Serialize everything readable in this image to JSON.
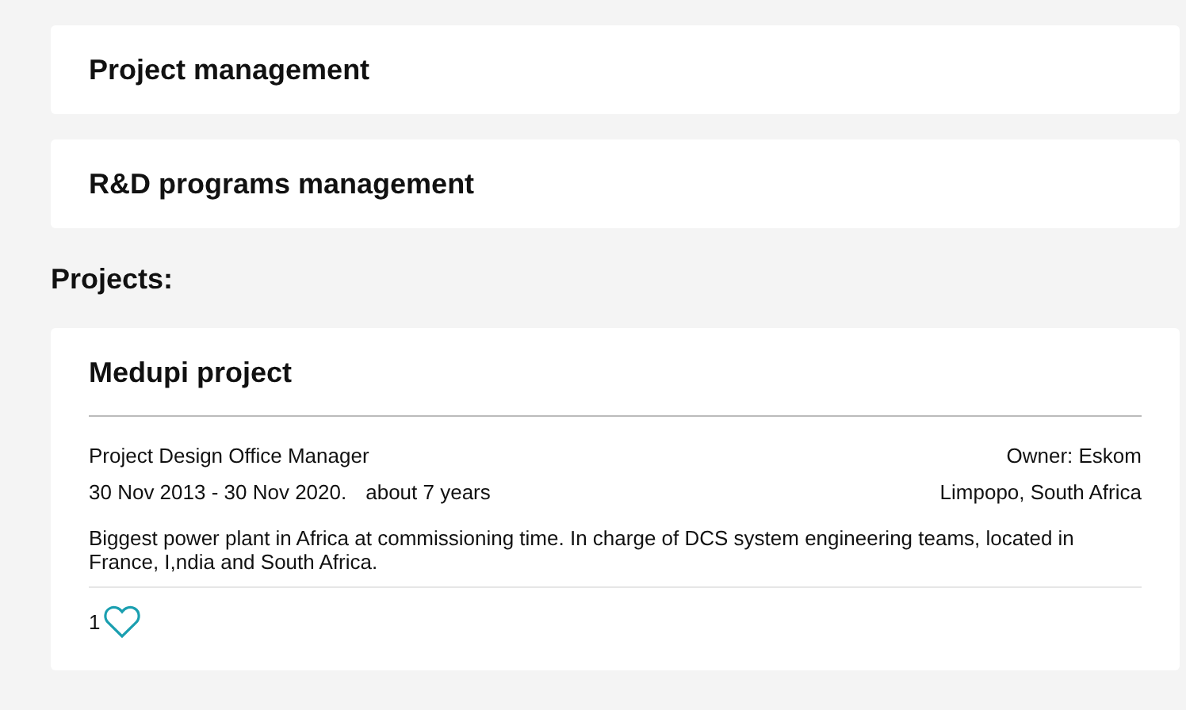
{
  "sections": [
    {
      "title": "Project management"
    },
    {
      "title": "R&D programs management"
    }
  ],
  "projects_heading": "Projects:",
  "projects": [
    {
      "title": "Medupi project",
      "role": "Project Design Office Manager",
      "owner": "Owner: Eskom",
      "dates": "30 Nov 2013 - 30 Nov 2020.",
      "duration": "about 7 years",
      "location": "Limpopo, South Africa",
      "description": "Biggest power plant in Africa at commissioning time. In charge of DCS system engineering teams, located in France, I,ndia and South Africa.",
      "likes": "1",
      "liked": false
    }
  ]
}
